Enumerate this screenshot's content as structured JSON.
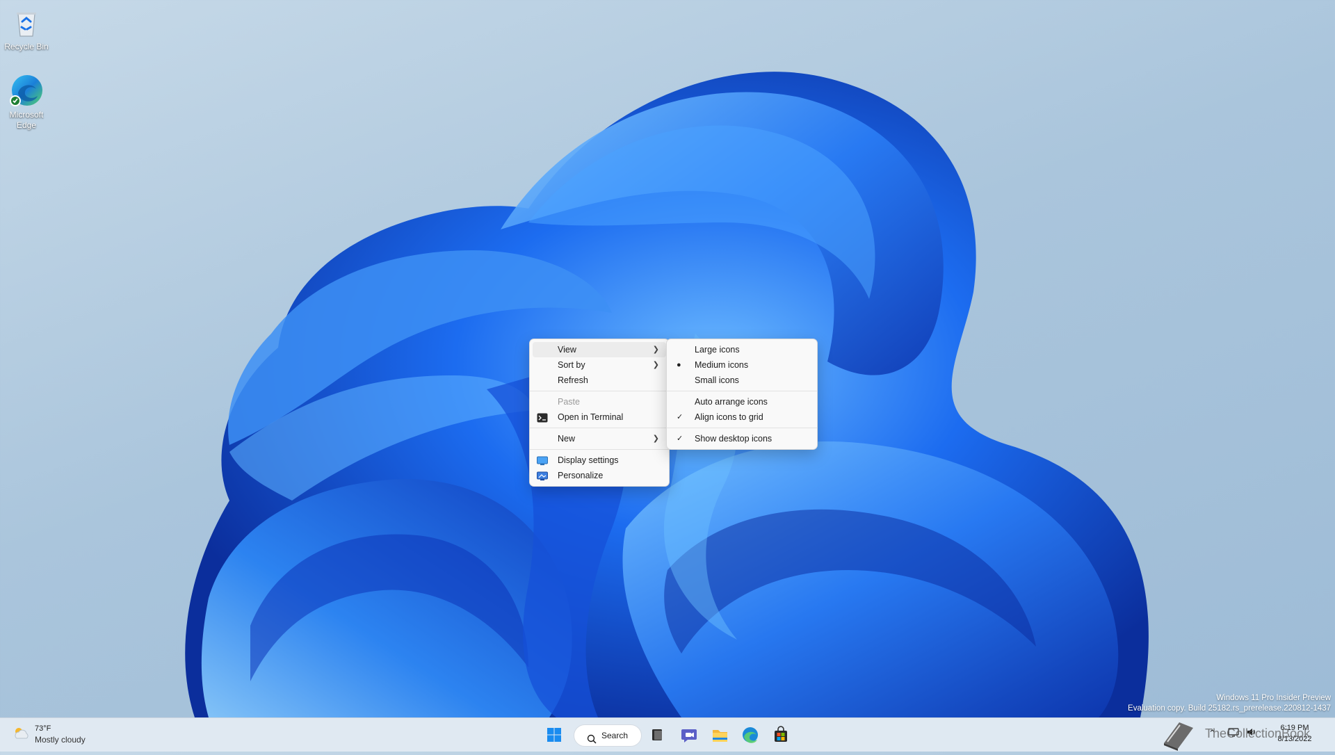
{
  "desktop": {
    "icons": [
      {
        "label": "Recycle Bin"
      },
      {
        "label": "Microsoft Edge"
      }
    ]
  },
  "context_menu": {
    "items": {
      "view": {
        "label": "View"
      },
      "sort_by": {
        "label": "Sort by"
      },
      "refresh": {
        "label": "Refresh"
      },
      "paste": {
        "label": "Paste",
        "disabled": true
      },
      "open_terminal": {
        "label": "Open in Terminal"
      },
      "new": {
        "label": "New"
      },
      "display_settings": {
        "label": "Display settings"
      },
      "personalize": {
        "label": "Personalize"
      }
    }
  },
  "view_submenu": {
    "items": {
      "large_icons": {
        "label": "Large icons"
      },
      "medium_icons": {
        "label": "Medium icons",
        "selected": true
      },
      "small_icons": {
        "label": "Small icons"
      },
      "auto_arrange": {
        "label": "Auto arrange icons",
        "checked": false
      },
      "align_grid": {
        "label": "Align icons to grid",
        "checked": true
      },
      "show_icons": {
        "label": "Show desktop icons",
        "checked": true
      }
    }
  },
  "watermark": {
    "line1": "Windows 11 Pro Insider Preview",
    "line2": "Evaluation copy. Build 25182.rs_prerelease.220812-1437"
  },
  "taskbar": {
    "weather": {
      "temp": "73°F",
      "condition": "Mostly cloudy"
    },
    "search_label": "Search",
    "clock": {
      "time": "6:19 PM",
      "date": "8/13/2022"
    },
    "overlay_text": "TheCollectionBook"
  },
  "colors": {
    "accent": "#0067c0",
    "wallpaper_bloom": "#1a5fe0",
    "menu_bg": "#f9f9f9"
  }
}
